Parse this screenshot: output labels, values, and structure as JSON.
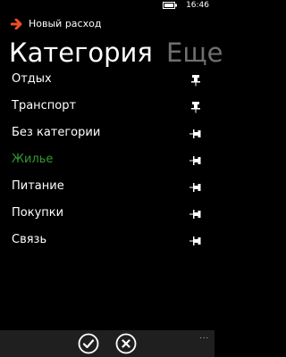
{
  "status_bar": {
    "time": "16:46"
  },
  "app": {
    "title": "Новый расход",
    "back_icon": "arrow-right-icon",
    "accent_color": "#e8502a"
  },
  "pivot": {
    "active_label": "Категория",
    "next_label": "Еще"
  },
  "categories": [
    {
      "label": "Отдых",
      "pinned": true
    },
    {
      "label": "Транспорт",
      "pinned": true
    },
    {
      "label": "Без категории",
      "pinned": false
    },
    {
      "label": "Жилье",
      "pinned": false,
      "selected": true
    },
    {
      "label": "Питание",
      "pinned": false
    },
    {
      "label": "Покупки",
      "pinned": false
    },
    {
      "label": "Связь",
      "pinned": false
    }
  ],
  "app_bar": {
    "buttons": [
      "check-icon",
      "close-icon"
    ],
    "more_label": "..."
  }
}
